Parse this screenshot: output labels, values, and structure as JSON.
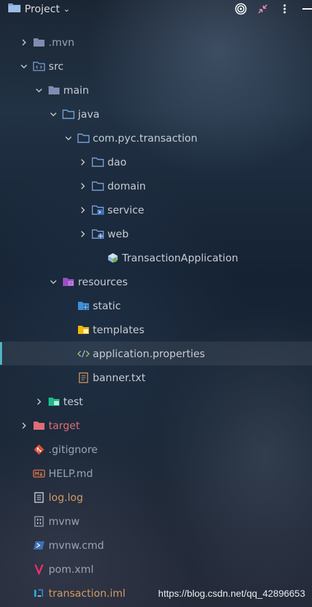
{
  "header": {
    "title": "Project",
    "icons": [
      "folder-icon",
      "chevron-down-icon",
      "target-icon",
      "collapse-icon",
      "more-icon",
      "minimize-icon"
    ]
  },
  "tree": [
    {
      "label": ".mvn",
      "depth": 0,
      "expanded": false,
      "icon": "folder-icon",
      "color": "dim"
    },
    {
      "label": "src",
      "depth": 0,
      "expanded": true,
      "icon": "source-folder-icon",
      "color": "normal"
    },
    {
      "label": "main",
      "depth": 1,
      "expanded": true,
      "icon": "folder-icon",
      "color": "normal"
    },
    {
      "label": "java",
      "depth": 2,
      "expanded": true,
      "icon": "source-root-icon",
      "color": "normal"
    },
    {
      "label": "com.pyc.transaction",
      "depth": 3,
      "expanded": true,
      "icon": "package-icon",
      "color": "normal"
    },
    {
      "label": "dao",
      "depth": 4,
      "expanded": false,
      "icon": "package-icon",
      "color": "normal"
    },
    {
      "label": "domain",
      "depth": 4,
      "expanded": false,
      "icon": "package-icon",
      "color": "normal"
    },
    {
      "label": "service",
      "depth": 4,
      "expanded": false,
      "icon": "service-package-icon",
      "color": "normal"
    },
    {
      "label": "web",
      "depth": 4,
      "expanded": false,
      "icon": "web-package-icon",
      "color": "normal"
    },
    {
      "label": "TransactionApplication",
      "depth": 5,
      "expanded": null,
      "icon": "spring-boot-icon",
      "color": "normal"
    },
    {
      "label": "resources",
      "depth": 2,
      "expanded": true,
      "icon": "resources-folder-icon",
      "color": "normal"
    },
    {
      "label": "static",
      "depth": 3,
      "expanded": null,
      "icon": "web-folder-icon",
      "color": "normal"
    },
    {
      "label": "templates",
      "depth": 3,
      "expanded": null,
      "icon": "templates-folder-icon",
      "color": "normal"
    },
    {
      "label": "application.properties",
      "depth": 3,
      "expanded": null,
      "icon": "code-file-icon",
      "color": "normal",
      "selected": true
    },
    {
      "label": "banner.txt",
      "depth": 3,
      "expanded": null,
      "icon": "text-file-icon",
      "color": "normal"
    },
    {
      "label": "test",
      "depth": 1,
      "expanded": false,
      "icon": "test-folder-icon",
      "color": "normal"
    },
    {
      "label": "target",
      "depth": 0,
      "expanded": false,
      "icon": "excluded-folder-icon",
      "color": "normal"
    },
    {
      "label": ".gitignore",
      "depth": 0,
      "expanded": null,
      "icon": "git-icon",
      "color": "dim"
    },
    {
      "label": "HELP.md",
      "depth": 0,
      "expanded": null,
      "icon": "markdown-icon",
      "color": "dim"
    },
    {
      "label": "log.log",
      "depth": 0,
      "expanded": null,
      "icon": "log-file-icon",
      "color": "orange"
    },
    {
      "label": "mvnw",
      "depth": 0,
      "expanded": null,
      "icon": "binary-file-icon",
      "color": "dim"
    },
    {
      "label": "mvnw.cmd",
      "depth": 0,
      "expanded": null,
      "icon": "terminal-file-icon",
      "color": "dim"
    },
    {
      "label": "pom.xml",
      "depth": 0,
      "expanded": null,
      "icon": "maven-icon",
      "color": "dim"
    },
    {
      "label": "transaction.iml",
      "depth": 0,
      "expanded": null,
      "icon": "iml-file-icon",
      "color": "orange"
    }
  ],
  "watermark": "https://blog.csdn.net/qq_42896653",
  "colors": {
    "accent": "#4fb7c2",
    "folder": "#7aa2d6",
    "red": "#e06c75",
    "orange": "#d19a66"
  }
}
